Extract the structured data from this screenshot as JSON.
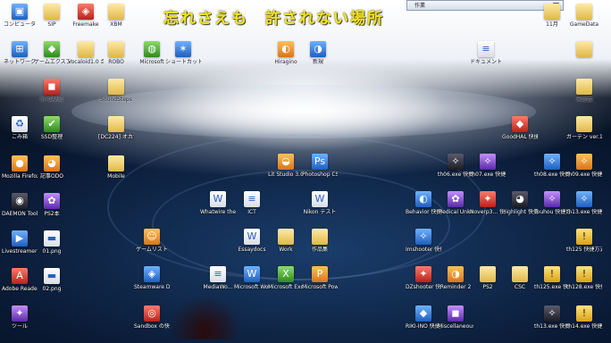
{
  "overlay": {
    "title": "忘れさえも　許されない場所",
    "window_tab": "作業"
  },
  "icons": {
    "c1": [
      "コンピュータ",
      "ネットワーク",
      "ごみ箱",
      "Mozilla Firefox",
      "DAEMON Tools Lite",
      "Livestreamer 快捷方式",
      "Adobe Reader X",
      "ツール"
    ],
    "c2": [
      "SIP",
      "ゲームエクスプローラー",
      "In-GAME",
      "SSD整理",
      "記事ODO",
      "PS2本",
      "01.png",
      "02.png"
    ],
    "c3": [
      "Freemake",
      "Vocaloid1.0 合成",
      "Mobile"
    ],
    "c4": [
      "XBM",
      "ROBO",
      "SoundSteps",
      "",
      "[DC224] オカサバット"
    ],
    "c5": [
      "Microsoft",
      "ショートカット"
    ],
    "misc": [
      "未定義",
      "Hiragino",
      "新規",
      "ドキュメント"
    ],
    "mid": [
      "Lit Studio 3.0",
      "Photoshop CS5",
      "Whatwire the conse...",
      "ICT",
      "Nikon テスト",
      "Essaydocs",
      "Work",
      "作品集",
      "MediaWo...",
      "Microsoft Word 2010",
      "Microsoft Excel 2010",
      "Microsoft PowerPoint",
      "ゲームリスト",
      "Steamware Download",
      "Sandbox の快捷方式"
    ],
    "right": [
      "GoodHAL 快捷方式",
      "ガーデン ver.1.11",
      "th06.exe 快捷方式",
      "th07.exe 快捷方式",
      "th08.exe 快捷方式",
      "th09.exe 快捷方式",
      "th10.exe 快捷方式",
      "th11.exe 快捷方式",
      "th12.exe 快捷方式",
      "Behavior 快捷方式",
      "Medical Unknown",
      "Noverp3... 快捷方式",
      "Highlight 快捷方式",
      "Touhou 快捷方式",
      "th13.exe 快捷方式",
      "Imshooter 快捷方式",
      "th125 快捷方式",
      "DZshooter 快捷方式",
      "Reminder 2",
      "PS2",
      "CSC",
      "th125.exe 快捷方式",
      "th128.exe 快捷方式",
      "RIKI-INO 快捷方式",
      "Miscellaneous 快捷方式",
      "th13.exe 快捷方式",
      "th14.exe 快捷方式",
      "11月",
      "GameData"
    ]
  }
}
